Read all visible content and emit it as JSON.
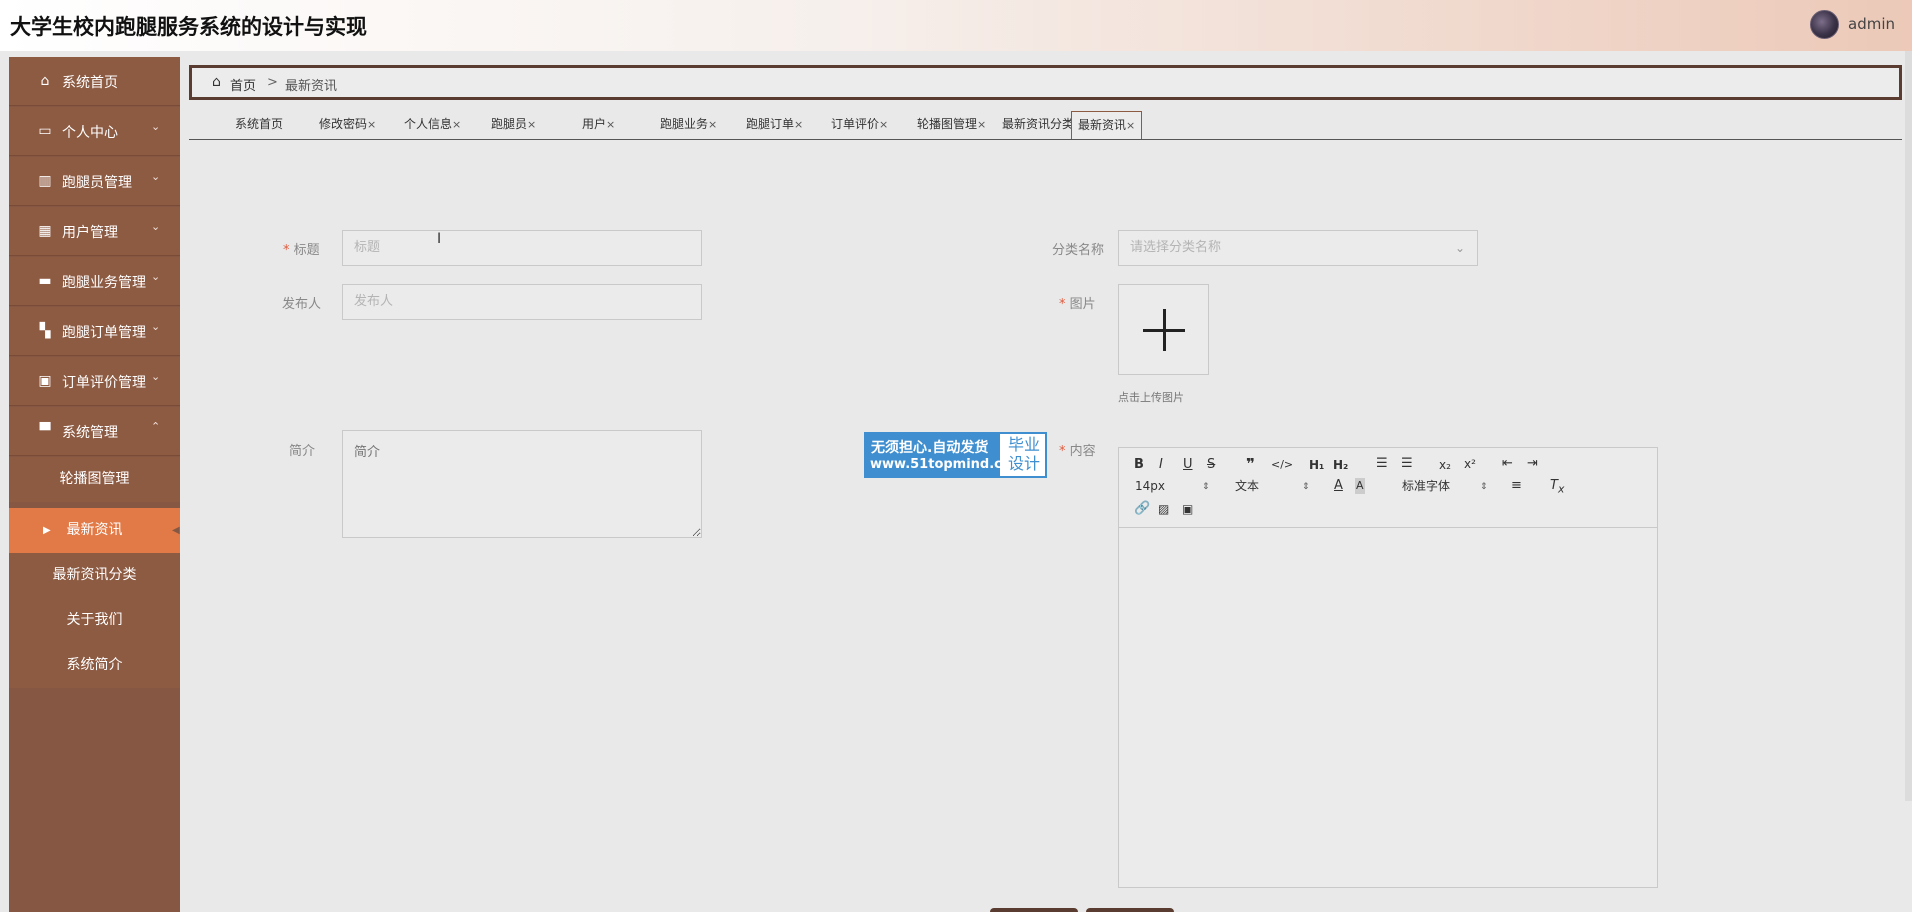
{
  "header": {
    "title": "大学生校内跑腿服务系统的设计与实现",
    "username": "admin"
  },
  "sidebar": {
    "items": [
      {
        "label": "系统首页",
        "icon": "home-icon",
        "arrow": ""
      },
      {
        "label": "个人中心",
        "icon": "card-icon",
        "arrow": "⌄"
      },
      {
        "label": "跑腿员管理",
        "icon": "books-icon",
        "arrow": "⌄"
      },
      {
        "label": "用户管理",
        "icon": "grid-icon",
        "arrow": "⌄"
      },
      {
        "label": "跑腿业务管理",
        "icon": "chat-icon",
        "arrow": "⌄"
      },
      {
        "label": "跑腿订单管理",
        "icon": "tiles-icon",
        "arrow": "⌄"
      },
      {
        "label": "订单评价管理",
        "icon": "clipboard-icon",
        "arrow": "⌄"
      },
      {
        "label": "系统管理",
        "icon": "settings-icon",
        "arrow": "⌃"
      }
    ],
    "sub_items": [
      {
        "label": "轮播图管理"
      },
      {
        "label": "最新资讯"
      },
      {
        "label": "最新资讯分类"
      },
      {
        "label": "关于我们"
      },
      {
        "label": "系统简介"
      }
    ]
  },
  "breadcrumb": {
    "home": "首页",
    "separator": ">",
    "current": "最新资讯"
  },
  "tabs": [
    {
      "label": "系统首页",
      "close": ""
    },
    {
      "label": "修改密码",
      "close": "×"
    },
    {
      "label": "个人信息",
      "close": "×"
    },
    {
      "label": "跑腿员",
      "close": "×"
    },
    {
      "label": "用户",
      "close": "×"
    },
    {
      "label": "跑腿业务",
      "close": "×"
    },
    {
      "label": "跑腿订单",
      "close": "×"
    },
    {
      "label": "订单评价",
      "close": "×"
    },
    {
      "label": "轮播图管理",
      "close": "×"
    },
    {
      "label": "最新资讯分类",
      "close": "×"
    },
    {
      "label": "最新资讯",
      "close": "×"
    }
  ],
  "form": {
    "title_label": "标题",
    "title_placeholder": "标题",
    "category_label": "分类名称",
    "category_placeholder": "请选择分类名称",
    "publisher_label": "发布人",
    "publisher_placeholder": "发布人",
    "image_label": "图片",
    "upload_hint": "点击上传图片",
    "intro_label": "简介",
    "intro_placeholder": "简介",
    "content_label": "内容",
    "required_mark": "*"
  },
  "watermark": {
    "line1": "无须担心.自动发货",
    "line2": "www.51topmind.com",
    "right": "毕业设计"
  },
  "editor": {
    "font_size": "14px",
    "text_style": "文本",
    "font_family": "标准字体"
  },
  "colors": {
    "sidebar": "#8d5a42",
    "active": "#e17a47",
    "border_dark": "#5a3d30",
    "required": "#e05a3d"
  }
}
